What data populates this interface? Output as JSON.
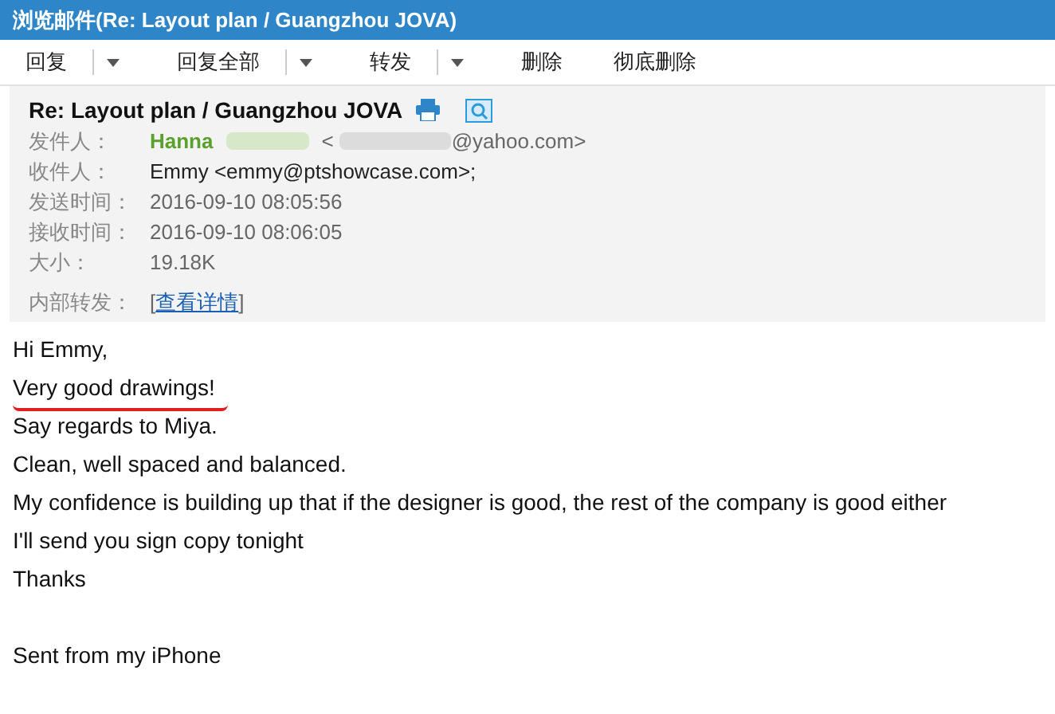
{
  "window": {
    "title": "浏览邮件(Re: Layout plan  / Guangzhou JOVA)"
  },
  "toolbar": [
    {
      "label": "回复",
      "kind": "split"
    },
    {
      "label": "回复全部",
      "kind": "split"
    },
    {
      "label": "转发",
      "kind": "split"
    },
    {
      "label": "删除",
      "kind": "button"
    },
    {
      "label": "彻底删除",
      "kind": "button"
    }
  ],
  "header": {
    "subject": "Re: Layout plan / Guangzhou JOVA",
    "fields": [
      {
        "label": "发件人：",
        "kind": "sender",
        "name": "Hanna",
        "address_start": "<",
        "address_end": "@yahoo.com>"
      },
      {
        "label": "收件人：",
        "kind": "text",
        "value": "Emmy <emmy@ptshowcase.com>;"
      },
      {
        "label": "发送时间：",
        "kind": "text",
        "value": "2016-09-10 08:05:56"
      },
      {
        "label": "接收时间：",
        "kind": "text",
        "value": "2016-09-10 08:06:05"
      },
      {
        "label": "大小：",
        "kind": "text",
        "value": "19.18K"
      },
      {
        "label": "内部转发：",
        "kind": "link",
        "open": "[",
        "value": "查看详情",
        "close": "]"
      }
    ]
  },
  "body": {
    "lines": [
      {
        "kind": "text",
        "text": "Hi Emmy,",
        "underlined": false
      },
      {
        "kind": "text",
        "text": "Very good drawings!",
        "underlined": true
      },
      {
        "kind": "text",
        "text": "Say regards to Miya.",
        "underlined": false
      },
      {
        "kind": "text",
        "text": "Clean, well spaced and balanced.",
        "underlined": false
      },
      {
        "kind": "text",
        "text": "My confidence is building up that if the designer is good, the rest of the company is good either",
        "underlined": false
      },
      {
        "kind": "text",
        "text": "I'll send you sign copy tonight",
        "underlined": false
      },
      {
        "kind": "text",
        "text": "Thanks",
        "underlined": false
      },
      {
        "kind": "blank"
      },
      {
        "kind": "text",
        "text": "Sent from my iPhone",
        "underlined": false
      }
    ]
  }
}
